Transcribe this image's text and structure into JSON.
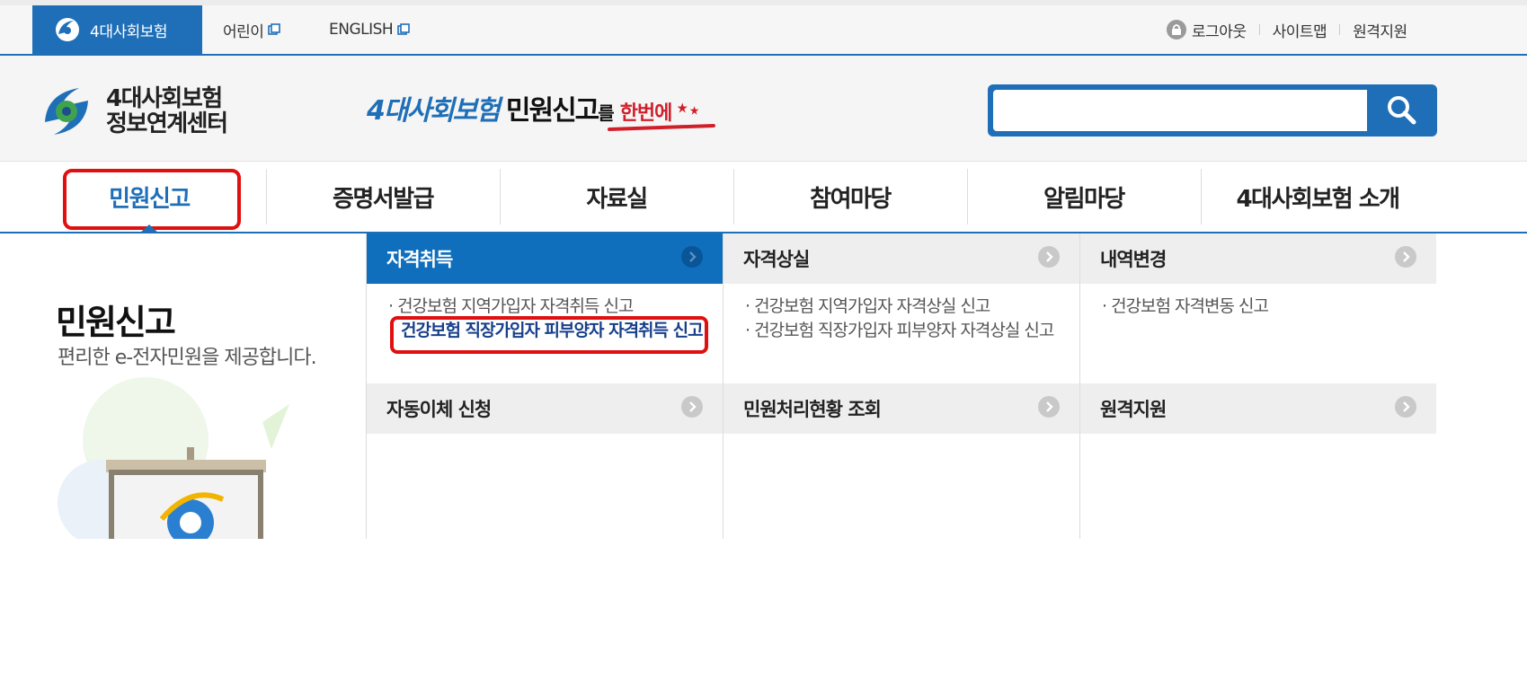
{
  "topbar": {
    "active_tab": "4대사회보험",
    "links": [
      {
        "label": "어린이"
      },
      {
        "label": "ENGLISH"
      }
    ],
    "utils": [
      {
        "label": "로그아웃"
      },
      {
        "label": "사이트맵"
      },
      {
        "label": "원격지원"
      }
    ]
  },
  "header": {
    "logo_line1": "4대사회보험",
    "logo_line2": "정보연계센터",
    "slogan_a": "4대사회보험",
    "slogan_b": "민원신고",
    "slogan_c": "를",
    "slogan_d": "한번에",
    "search_value": ""
  },
  "gnb": {
    "items": [
      {
        "label": "민원신고"
      },
      {
        "label": "증명서발급"
      },
      {
        "label": "자료실"
      },
      {
        "label": "참여마당"
      },
      {
        "label": "알림마당"
      },
      {
        "label": "4대사회보험 소개"
      }
    ]
  },
  "left": {
    "title": "민원신고",
    "desc": "편리한 e-전자민원을 제공합니다."
  },
  "menu": {
    "categories": [
      {
        "label": "자격취득"
      },
      {
        "label": "자격상실"
      },
      {
        "label": "내역변경"
      },
      {
        "label": "자동이체 신청"
      },
      {
        "label": "민원처리현황 조회"
      },
      {
        "label": "원격지원"
      }
    ],
    "col1_items": [
      {
        "label": "· 건강보험 지역가입자 자격취득 신고"
      },
      {
        "label": "건강보험 직장가입자 피부양자 자격취득 신고"
      }
    ],
    "col2_items": [
      {
        "label": "· 건강보험 지역가입자 자격상실 신고"
      },
      {
        "label": "· 건강보험 직장가입자 피부양자 자격상실 신고"
      }
    ],
    "col3_items": [
      {
        "label": "· 건강보험 자격변동 신고"
      }
    ]
  },
  "colors": {
    "brand_blue": "#1f6fb8",
    "highlight_red": "#e01010",
    "slogan_red": "#d11f2a"
  }
}
